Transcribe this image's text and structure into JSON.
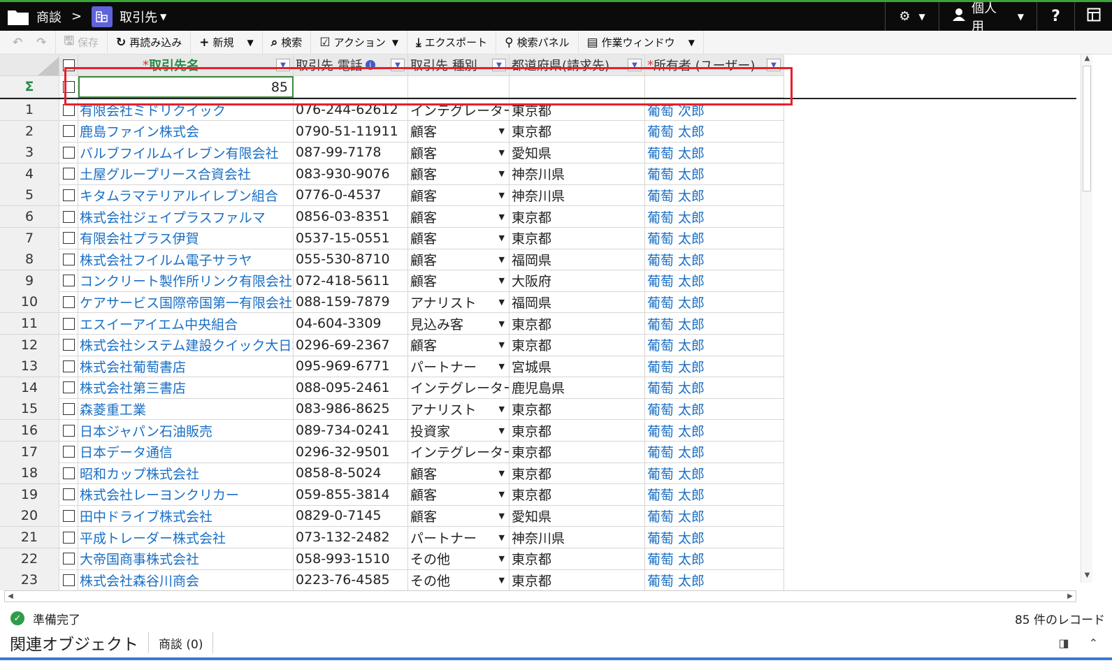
{
  "topbar": {
    "breadcrumb_parent": "商談",
    "breadcrumb_sep": ">",
    "object_title": "取引先",
    "user_label": "個人用",
    "help_label": "?"
  },
  "toolbar": {
    "save_label": "保存",
    "reload_label": "再読み込み",
    "new_label": "新規",
    "search_label": "検索",
    "action_label": "アクション",
    "export_label": "エクスポート",
    "search_panel_label": "検索パネル",
    "work_window_label": "作業ウィンドウ"
  },
  "grid": {
    "headers": {
      "name": "取引先名",
      "phone": "取引先 電話",
      "type": "取引先 種別",
      "pref": "都道府県(請求先)",
      "owner": "所有者 (ユーザー)"
    },
    "sum_symbol": "Σ",
    "sum_value": "85",
    "rows": [
      {
        "n": "1",
        "name": "有限会社ミドリクイック",
        "phone": "076-244-62612",
        "type": "インテグレーター",
        "pref": "東京都",
        "owner": "葡萄 次郎"
      },
      {
        "n": "2",
        "name": "鹿島ファイン株式会",
        "phone": "0790-51-11911",
        "type": "顧客",
        "pref": "東京都",
        "owner": "葡萄 太郎"
      },
      {
        "n": "3",
        "name": "バルブフイルムイレブン有限会社",
        "phone": "087-99-7178",
        "type": "顧客",
        "pref": "愛知県",
        "owner": "葡萄 太郎"
      },
      {
        "n": "4",
        "name": "土屋グループリース合資会社",
        "phone": "083-930-9076",
        "type": "顧客",
        "pref": "神奈川県",
        "owner": "葡萄 太郎"
      },
      {
        "n": "5",
        "name": "キタムラマテリアルイレブン組合",
        "phone": "0776-0-4537",
        "type": "顧客",
        "pref": "神奈川県",
        "owner": "葡萄 太郎"
      },
      {
        "n": "6",
        "name": "株式会社ジェイプラスファルマ",
        "phone": "0856-03-8351",
        "type": "顧客",
        "pref": "東京都",
        "owner": "葡萄 太郎"
      },
      {
        "n": "7",
        "name": "有限会社プラス伊賀",
        "phone": "0537-15-0551",
        "type": "顧客",
        "pref": "東京都",
        "owner": "葡萄 太郎"
      },
      {
        "n": "8",
        "name": "株式会社フイルム電子サラヤ",
        "phone": "055-530-8710",
        "type": "顧客",
        "pref": "福岡県",
        "owner": "葡萄 太郎"
      },
      {
        "n": "9",
        "name": "コンクリート製作所リンク有限会社",
        "phone": "072-418-5611",
        "type": "顧客",
        "pref": "大阪府",
        "owner": "葡萄 太郎"
      },
      {
        "n": "10",
        "name": "ケアサービス国際帝国第一有限会社",
        "phone": "088-159-7879",
        "type": "アナリスト",
        "pref": "福岡県",
        "owner": "葡萄 太郎"
      },
      {
        "n": "11",
        "name": "エスイーアイエム中央組合",
        "phone": "04-604-3309",
        "type": "見込み客",
        "pref": "東京都",
        "owner": "葡萄 太郎"
      },
      {
        "n": "12",
        "name": "株式会社システム建設クイック大日本",
        "phone": "0296-69-2367",
        "type": "顧客",
        "pref": "東京都",
        "owner": "葡萄 太郎"
      },
      {
        "n": "13",
        "name": "株式会社葡萄書店",
        "phone": "095-969-6771",
        "type": "パートナー",
        "pref": "宮城県",
        "owner": "葡萄 太郎"
      },
      {
        "n": "14",
        "name": "株式会社第三書店",
        "phone": "088-095-2461",
        "type": "インテグレーター",
        "pref": "鹿児島県",
        "owner": "葡萄 太郎"
      },
      {
        "n": "15",
        "name": "森菱重工業",
        "phone": "083-986-8625",
        "type": "アナリスト",
        "pref": "東京都",
        "owner": "葡萄 太郎"
      },
      {
        "n": "16",
        "name": "日本ジャパン石油販売",
        "phone": "089-734-0241",
        "type": "投資家",
        "pref": "東京都",
        "owner": "葡萄 太郎"
      },
      {
        "n": "17",
        "name": "日本データ通信",
        "phone": "0296-32-9501",
        "type": "インテグレーター",
        "pref": "東京都",
        "owner": "葡萄 太郎"
      },
      {
        "n": "18",
        "name": "昭和カップ株式会社",
        "phone": "0858-8-5024",
        "type": "顧客",
        "pref": "東京都",
        "owner": "葡萄 太郎"
      },
      {
        "n": "19",
        "name": "株式会社レーヨンクリカー",
        "phone": "059-855-3814",
        "type": "顧客",
        "pref": "東京都",
        "owner": "葡萄 太郎"
      },
      {
        "n": "20",
        "name": "田中ドライブ株式会社",
        "phone": "0829-0-7145",
        "type": "顧客",
        "pref": "愛知県",
        "owner": "葡萄 太郎"
      },
      {
        "n": "21",
        "name": "平成トレーダー株式会社",
        "phone": "073-132-2482",
        "type": "パートナー",
        "pref": "神奈川県",
        "owner": "葡萄 太郎"
      },
      {
        "n": "22",
        "name": "大帝国商事株式会社",
        "phone": "058-993-1510",
        "type": "その他",
        "pref": "東京都",
        "owner": "葡萄 太郎"
      },
      {
        "n": "23",
        "name": "株式会社森谷川商会",
        "phone": "0223-76-4585",
        "type": "その他",
        "pref": "東京都",
        "owner": "葡萄 太郎"
      }
    ]
  },
  "status": {
    "ready_text": "準備完了",
    "record_count": "85 件のレコード"
  },
  "bottom": {
    "related_label": "関連オブジェクト",
    "deals_tab": "商談 (0)"
  }
}
